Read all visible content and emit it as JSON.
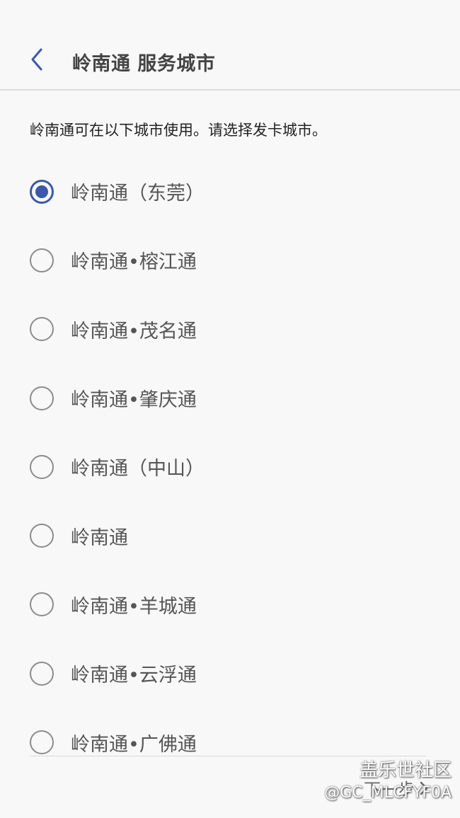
{
  "header": {
    "title": "岭南通 服务城市"
  },
  "description": "岭南通可在以下城市使用。请选择发卡城市。",
  "options": [
    {
      "label": "岭南通（东莞）",
      "selected": true
    },
    {
      "label": "岭南通•榕江通",
      "selected": false
    },
    {
      "label": "岭南通•茂名通",
      "selected": false
    },
    {
      "label": "岭南通•肇庆通",
      "selected": false
    },
    {
      "label": "岭南通（中山）",
      "selected": false
    },
    {
      "label": "岭南通",
      "selected": false
    },
    {
      "label": "岭南通•羊城通",
      "selected": false
    },
    {
      "label": "岭南通•云浮通",
      "selected": false
    },
    {
      "label": "岭南通•广佛通",
      "selected": false
    }
  ],
  "footer": {
    "next_label": "下一步"
  },
  "watermark": {
    "line1": "盖乐世社区",
    "line2": "@GC_MLCFYF0A"
  },
  "colors": {
    "accent": "#3a59a9",
    "radio_border": "#8c8c8c"
  }
}
